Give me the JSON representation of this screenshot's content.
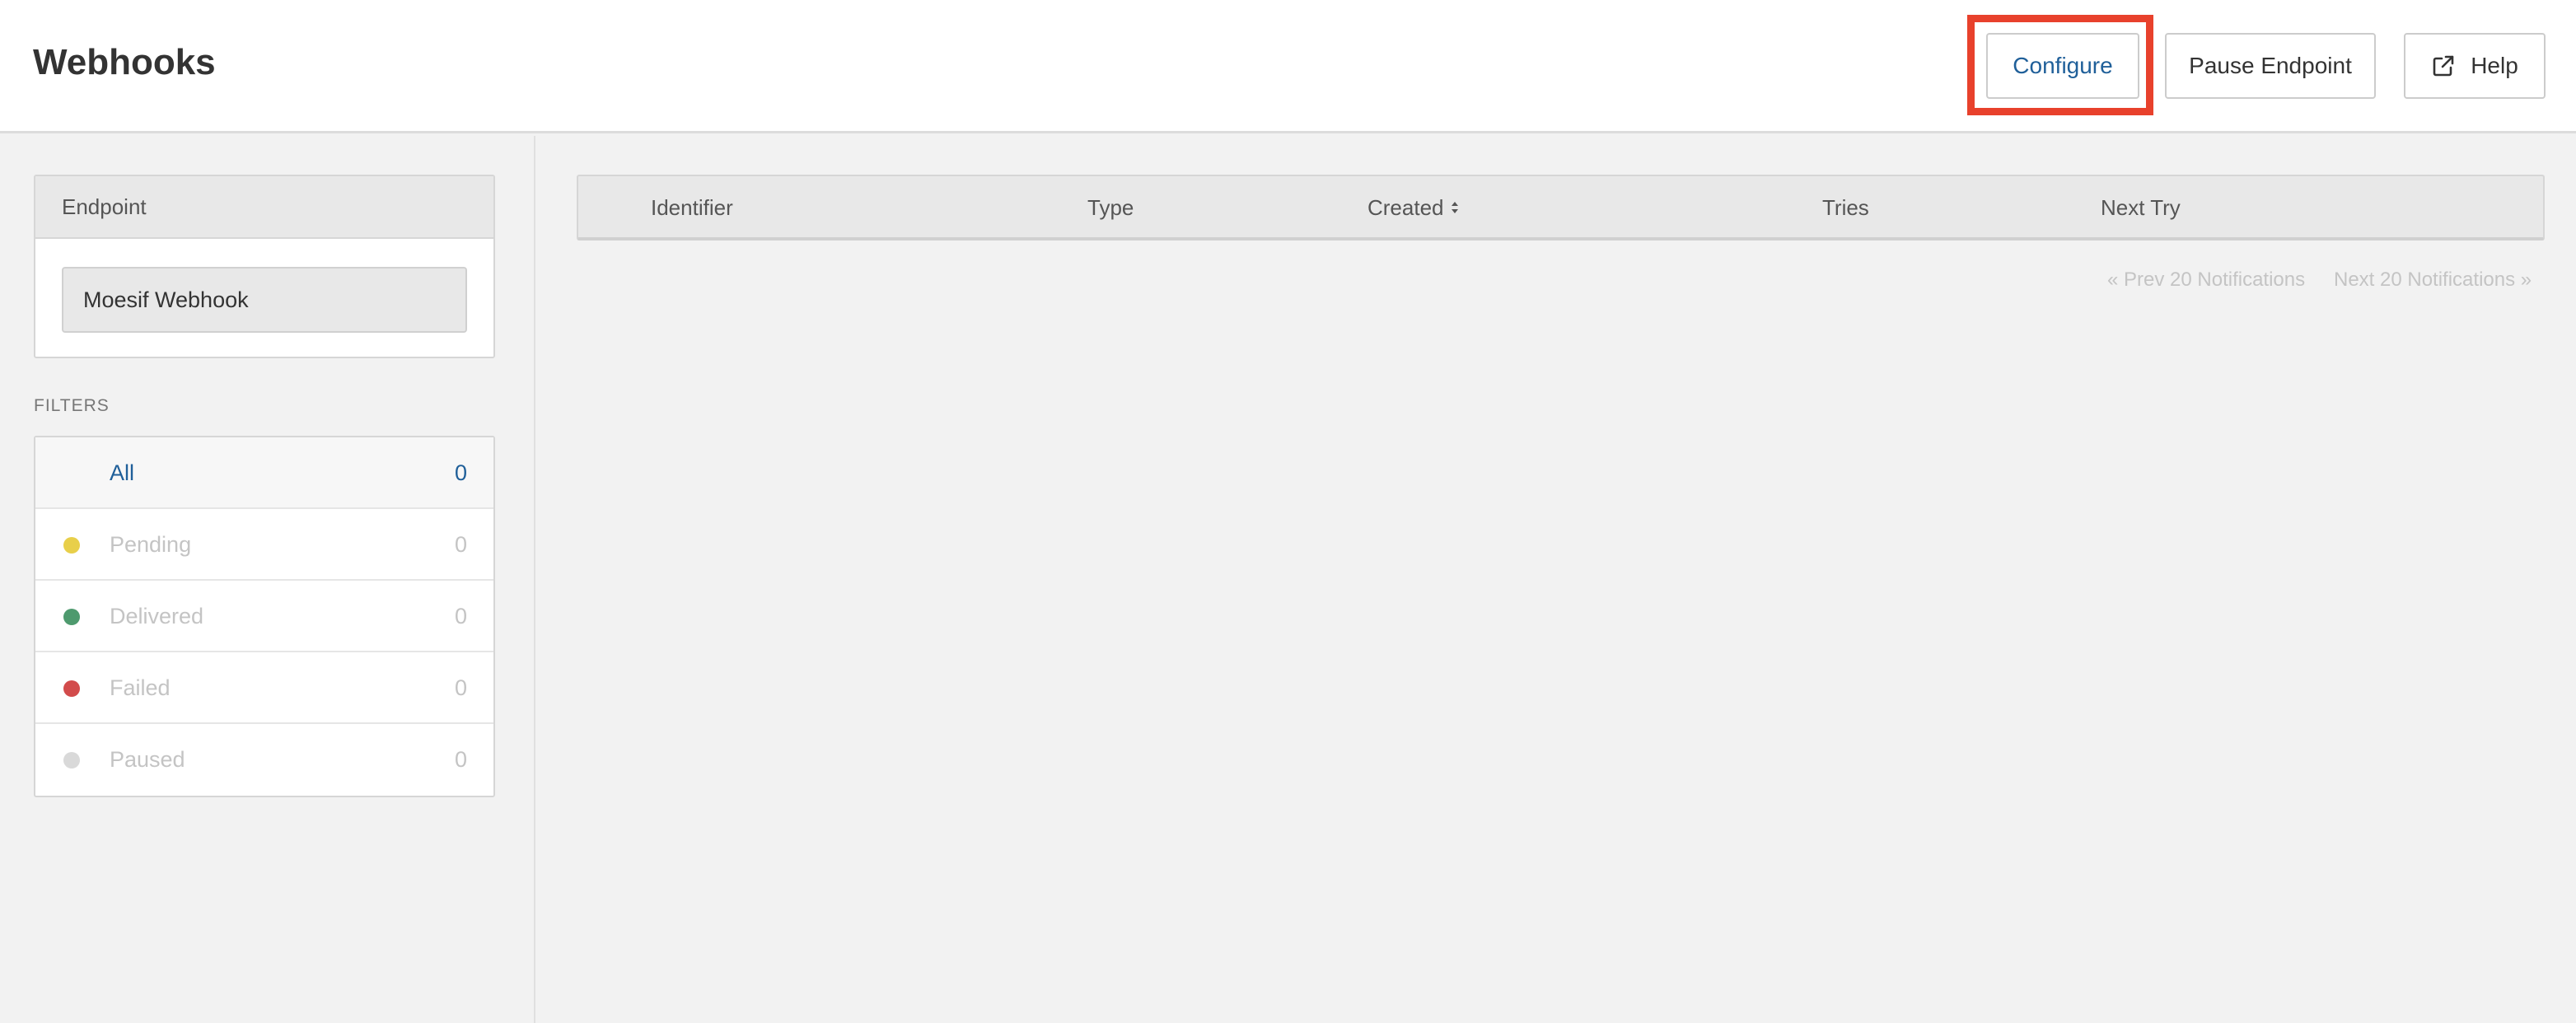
{
  "header": {
    "title": "Webhooks",
    "buttons": {
      "configure": "Configure",
      "pause": "Pause Endpoint",
      "help": "Help"
    }
  },
  "sidebar": {
    "endpoint_panel_title": "Endpoint",
    "endpoint_value": "Moesif Webhook",
    "filters_title": "FILTERS",
    "filters": [
      {
        "label": "All",
        "count": "0",
        "dot_color": "",
        "active": true
      },
      {
        "label": "Pending",
        "count": "0",
        "dot_color": "#e8cf4a",
        "active": false
      },
      {
        "label": "Delivered",
        "count": "0",
        "dot_color": "#4e9a6e",
        "active": false
      },
      {
        "label": "Failed",
        "count": "0",
        "dot_color": "#d24b4b",
        "active": false
      },
      {
        "label": "Paused",
        "count": "0",
        "dot_color": "#d9d9d9",
        "active": false
      }
    ]
  },
  "table": {
    "columns": [
      "Identifier",
      "Type",
      "Created",
      "Tries",
      "Next Try"
    ],
    "sort_icon": "sort-icon"
  },
  "pagination": {
    "prev": "« Prev 20 Notifications",
    "next": "Next 20 Notifications »"
  },
  "colors": {
    "accent": "#1f5f99",
    "highlight": "#e8412c"
  }
}
